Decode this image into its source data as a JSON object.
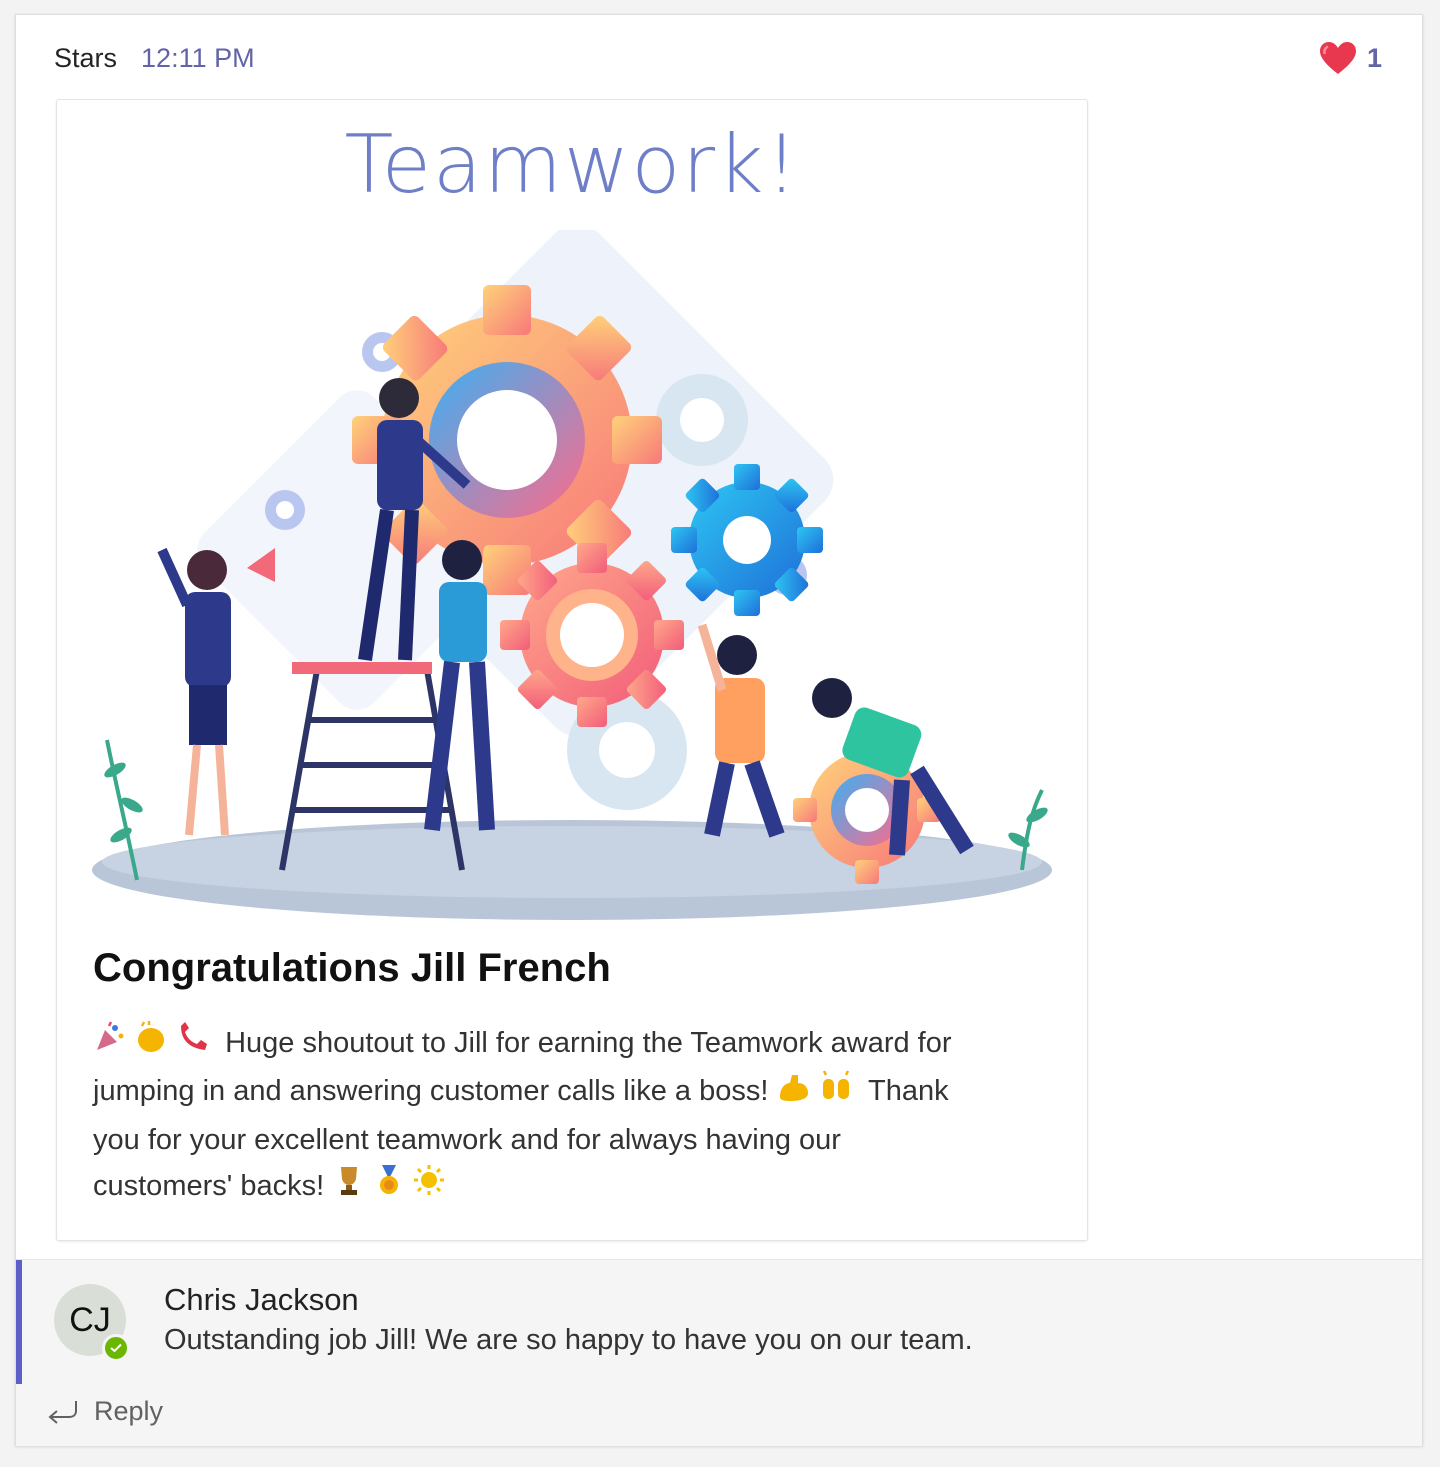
{
  "post": {
    "author": "Stars",
    "time": "12:11 PM",
    "reaction": {
      "icon": "heart-icon",
      "count": "1",
      "color": "#e8384f"
    }
  },
  "card": {
    "title": "Teamwork!",
    "heading": "Congratulations Jill French",
    "body_line1": "Huge shoutout to Jill for earning the Teamwork award for",
    "body_line2": "jumping in and answering customer calls like a boss!",
    "body_line2b": "Thank",
    "body_line3": "you for your excellent teamwork and for always having our",
    "body_line4": "customers' backs!",
    "emojis_start": [
      "party-popper-icon",
      "clapping-hands-icon",
      "telephone-icon"
    ],
    "emojis_mid": [
      "flexed-biceps-icon",
      "raising-hands-icon"
    ],
    "emojis_end": [
      "trophy-icon",
      "medal-icon",
      "sun-icon"
    ]
  },
  "reply": {
    "avatar_initials": "CJ",
    "name": "Chris Jackson",
    "text": "Outstanding job Jill! We are so happy to have you on our team.",
    "reply_label": "Reply",
    "accent": "#5b5fc7"
  }
}
